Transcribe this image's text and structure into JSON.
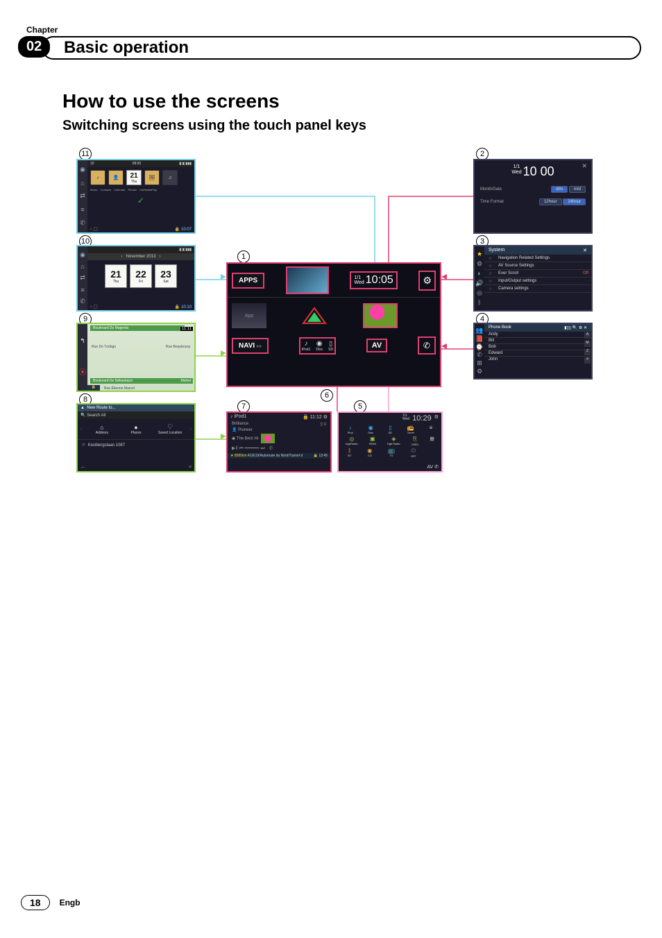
{
  "chapter": {
    "label": "Chapter",
    "number": "02",
    "title": "Basic operation"
  },
  "headings": {
    "h1": "How to use the screens",
    "h2": "Switching screens using the touch panel keys"
  },
  "callouts": {
    "c1": "1",
    "c2": "2",
    "c3": "3",
    "c4": "4",
    "c5": "5",
    "c6": "6",
    "c7": "7",
    "c8": "8",
    "c9": "9",
    "c10": "10",
    "c11": "11"
  },
  "center_hub": {
    "apps_label": "APPS",
    "app_sub": "App",
    "navi_label": "NAVI",
    "date_small": "1/1",
    "date_day": "Wed",
    "clock": "10:05",
    "bottom": {
      "ipod": "iPod1",
      "disc": "Disc",
      "sd": "SD",
      "av": "AV"
    }
  },
  "panel2": {
    "date_small": "1/1",
    "date_day": "Wed",
    "clock": "10 00",
    "row1_label": "Month/Date",
    "row1_b1": "d/m",
    "row1_b2": "m/d",
    "row2_label": "Time Format",
    "row2_b1": "12hour",
    "row2_b2": "24hour"
  },
  "panel3": {
    "title": "System",
    "items": [
      "Navigation Related Settings",
      "AV Source Settings",
      "Ever Scroll",
      "Input/Output settings",
      "Camera settings"
    ],
    "off": "Off"
  },
  "panel4": {
    "title": "Phone Book",
    "items": [
      "Andy",
      "Bill",
      "Bob",
      "Edward",
      "John"
    ],
    "letters": [
      "A",
      "M",
      "Z",
      "#"
    ]
  },
  "panel5": {
    "date_small": "1/1",
    "date_day": "Wed",
    "clock": "10:29",
    "row1": [
      "iPod",
      "Disc",
      "SD",
      "Tuner"
    ],
    "row2": [
      "AppRadio",
      "HDMI",
      "Dgtl Radio",
      "USB1"
    ],
    "row3": [
      "BT",
      "CD",
      "TV",
      "OFF"
    ],
    "av": "AV"
  },
  "panel7": {
    "source": "iPod1",
    "time": "11:12",
    "artist": "Pioneer",
    "track_prefix": "The Best Hi",
    "status": "8585km",
    "road": "A1/E19/Autoroute du Nord/Tunnel d",
    "eta": "13:45"
  },
  "panel8": {
    "title": "New Route to...",
    "search": "Search All",
    "tabs": [
      "Address",
      "Places",
      "Saved Location"
    ],
    "result": "Kestbergslaan 1087"
  },
  "panel9": {
    "cur": "Boulevard Du Magenta",
    "t": "11:11",
    "r1": "Rue De Turbigo",
    "r2": "Rue Beaubourg",
    "r3": "Boulevard De Sébastopol",
    "r4": "Michel",
    "r5": "Rue Étienne Marcel"
  },
  "panel10": {
    "month": "November 2013",
    "d1": "21",
    "d1s": "Thu",
    "d2": "22",
    "d2s": "Fri",
    "d3": "23",
    "d3s": "Sat",
    "t": "10:10"
  },
  "panel11": {
    "tabs": [
      "Music",
      "Contacts",
      "Calendar",
      "Photos",
      "CarMediaPlay"
    ],
    "cal": "21",
    "cals": "Thu",
    "t": "10:07"
  },
  "footer": {
    "page": "18",
    "lang": "Engb"
  }
}
